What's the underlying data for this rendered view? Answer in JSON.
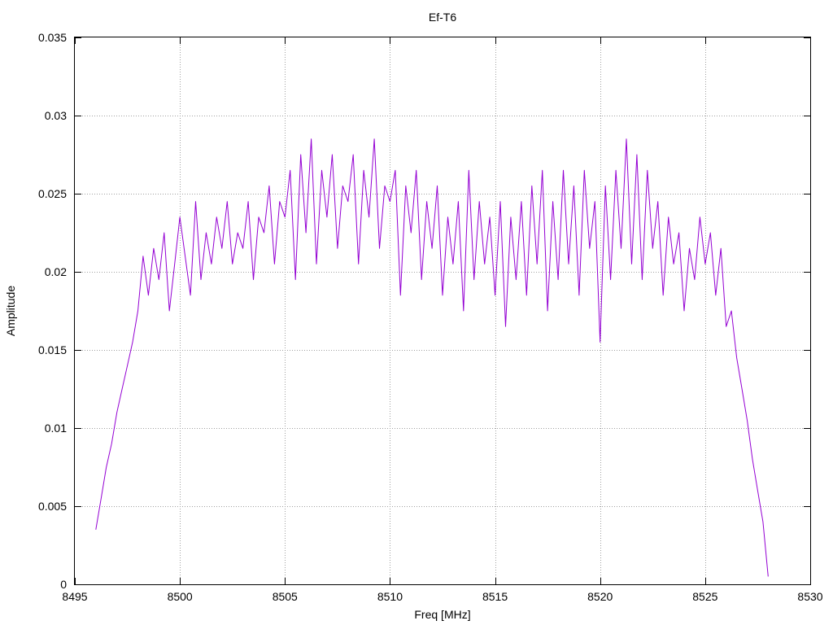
{
  "chart_data": {
    "type": "line",
    "title": "Ef-T6",
    "xlabel": "Freq [MHz]",
    "ylabel": "Amplitude",
    "xlim": [
      8495,
      8530
    ],
    "ylim": [
      0,
      0.035
    ],
    "x_ticks": [
      8495,
      8500,
      8505,
      8510,
      8515,
      8520,
      8525,
      8530
    ],
    "x_tick_labels": [
      "8495",
      "8500",
      "8505",
      "8510",
      "8515",
      "8520",
      "8525",
      "8530"
    ],
    "y_ticks": [
      0,
      0.005,
      0.01,
      0.015,
      0.02,
      0.025,
      0.03,
      0.035
    ],
    "y_tick_labels": [
      "0",
      "0.005",
      "0.01",
      "0.015",
      "0.02",
      "0.025",
      "0.03",
      "0.035"
    ],
    "grid": true,
    "color": "#9400d3",
    "series": [
      {
        "x": [
          8496.0,
          8496.25,
          8496.5,
          8496.75,
          8497.0,
          8497.25,
          8497.5,
          8497.75,
          8498.0,
          8498.25,
          8498.5,
          8498.75,
          8499.0,
          8499.25,
          8499.5,
          8499.75,
          8500.0,
          8500.25,
          8500.5,
          8500.75,
          8501.0,
          8501.25,
          8501.5,
          8501.75,
          8502.0,
          8502.25,
          8502.5,
          8502.75,
          8503.0,
          8503.25,
          8503.5,
          8503.75,
          8504.0,
          8504.25,
          8504.5,
          8504.75,
          8505.0,
          8505.25,
          8505.5,
          8505.75,
          8506.0,
          8506.25,
          8506.5,
          8506.75,
          8507.0,
          8507.25,
          8507.5,
          8507.75,
          8508.0,
          8508.25,
          8508.5,
          8508.75,
          8509.0,
          8509.25,
          8509.5,
          8509.75,
          8510.0,
          8510.25,
          8510.5,
          8510.75,
          8511.0,
          8511.25,
          8511.5,
          8511.75,
          8512.0,
          8512.25,
          8512.5,
          8512.75,
          8513.0,
          8513.25,
          8513.5,
          8513.75,
          8514.0,
          8514.25,
          8514.5,
          8514.75,
          8515.0,
          8515.25,
          8515.5,
          8515.75,
          8516.0,
          8516.25,
          8516.5,
          8516.75,
          8517.0,
          8517.25,
          8517.5,
          8517.75,
          8518.0,
          8518.25,
          8518.5,
          8518.75,
          8519.0,
          8519.25,
          8519.5,
          8519.75,
          8520.0,
          8520.25,
          8520.5,
          8520.75,
          8521.0,
          8521.25,
          8521.5,
          8521.75,
          8522.0,
          8522.25,
          8522.5,
          8522.75,
          8523.0,
          8523.25,
          8523.5,
          8523.75,
          8524.0,
          8524.25,
          8524.5,
          8524.75,
          8525.0,
          8525.25,
          8525.5,
          8525.75,
          8526.0,
          8526.25,
          8526.5,
          8526.75,
          8527.0,
          8527.25,
          8527.5,
          8527.75,
          8528.0
        ],
        "y": [
          0.0035,
          0.0055,
          0.0075,
          0.009,
          0.011,
          0.0125,
          0.014,
          0.0155,
          0.0175,
          0.021,
          0.0185,
          0.0215,
          0.0195,
          0.0225,
          0.0175,
          0.0205,
          0.0235,
          0.021,
          0.0185,
          0.0245,
          0.0195,
          0.0225,
          0.0205,
          0.0235,
          0.0215,
          0.0245,
          0.0205,
          0.0225,
          0.0215,
          0.0245,
          0.0195,
          0.0235,
          0.0225,
          0.0255,
          0.0205,
          0.0245,
          0.0235,
          0.0265,
          0.0195,
          0.0275,
          0.0225,
          0.0285,
          0.0205,
          0.0265,
          0.0235,
          0.0275,
          0.0215,
          0.0255,
          0.0245,
          0.0275,
          0.0205,
          0.0265,
          0.0235,
          0.0285,
          0.0215,
          0.0255,
          0.0245,
          0.0265,
          0.0185,
          0.0255,
          0.0225,
          0.0265,
          0.0195,
          0.0245,
          0.0215,
          0.0255,
          0.0185,
          0.0235,
          0.0205,
          0.0245,
          0.0175,
          0.0265,
          0.0195,
          0.0245,
          0.0205,
          0.0235,
          0.0185,
          0.0245,
          0.0165,
          0.0235,
          0.0195,
          0.0245,
          0.0185,
          0.0255,
          0.0205,
          0.0265,
          0.0175,
          0.0245,
          0.0195,
          0.0265,
          0.0205,
          0.0255,
          0.0185,
          0.0265,
          0.0215,
          0.0245,
          0.0155,
          0.0255,
          0.0195,
          0.0265,
          0.0215,
          0.0285,
          0.0205,
          0.0275,
          0.0195,
          0.0265,
          0.0215,
          0.0245,
          0.0185,
          0.0235,
          0.0205,
          0.0225,
          0.0175,
          0.0215,
          0.0195,
          0.0235,
          0.0205,
          0.0225,
          0.0185,
          0.0215,
          0.0165,
          0.0175,
          0.0145,
          0.0125,
          0.0105,
          0.008,
          0.006,
          0.004,
          0.0005
        ]
      }
    ]
  }
}
